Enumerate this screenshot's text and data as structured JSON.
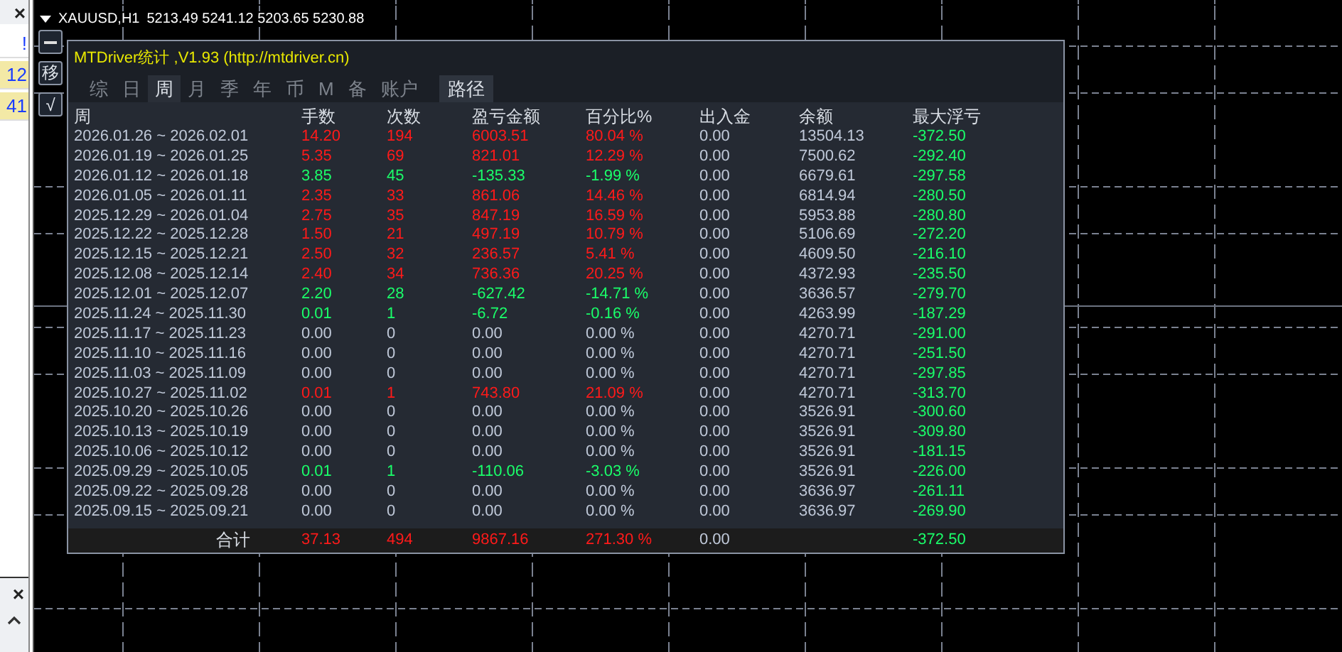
{
  "left_panel": {
    "close_top": "×",
    "cells": [
      {
        "text": "!",
        "highlighted": false
      },
      {
        "text": "12",
        "highlighted": true
      },
      {
        "text": "41",
        "highlighted": true
      }
    ],
    "close_bottom": "×"
  },
  "chart": {
    "symbol": "XAUUSD,H1",
    "prices": "5213.49 5241.12 5203.65 5230.88"
  },
  "side_buttons": [
    "移",
    "√"
  ],
  "panel": {
    "title": "MTDriver统计 ,V1.93 (http://mtdriver.cn)",
    "tabs": [
      {
        "label": "综",
        "selected": false
      },
      {
        "label": "日",
        "selected": false
      },
      {
        "label": "周",
        "selected": true
      },
      {
        "label": "月",
        "selected": false
      },
      {
        "label": "季",
        "selected": false
      },
      {
        "label": "年",
        "selected": false
      },
      {
        "label": "币",
        "selected": false
      },
      {
        "label": "M",
        "selected": false
      },
      {
        "label": "备",
        "selected": false
      },
      {
        "label": "账户",
        "selected": false
      }
    ],
    "path_button": "路径",
    "table": {
      "columns": [
        "周",
        "手数",
        "次数",
        "盈亏金额",
        "百分比%",
        "出入金",
        "余额",
        "最大浮亏"
      ],
      "rows": [
        {
          "cells": [
            "2026.01.26 ~ 2026.02.01",
            "14.20",
            "194",
            "6003.51",
            "80.04 %",
            "0.00",
            "13504.13",
            "-372.50"
          ],
          "kind": "profit"
        },
        {
          "cells": [
            "2026.01.19 ~ 2026.01.25",
            "5.35",
            "69",
            "821.01",
            "12.29 %",
            "0.00",
            "7500.62",
            "-292.40"
          ],
          "kind": "profit"
        },
        {
          "cells": [
            "2026.01.12 ~ 2026.01.18",
            "3.85",
            "45",
            "-135.33",
            "-1.99 %",
            "0.00",
            "6679.61",
            "-297.58"
          ],
          "kind": "loss"
        },
        {
          "cells": [
            "2026.01.05 ~ 2026.01.11",
            "2.35",
            "33",
            "861.06",
            "14.46 %",
            "0.00",
            "6814.94",
            "-280.50"
          ],
          "kind": "profit"
        },
        {
          "cells": [
            "2025.12.29 ~ 2026.01.04",
            "2.75",
            "35",
            "847.19",
            "16.59 %",
            "0.00",
            "5953.88",
            "-280.80"
          ],
          "kind": "profit"
        },
        {
          "cells": [
            "2025.12.22 ~ 2025.12.28",
            "1.50",
            "21",
            "497.19",
            "10.79 %",
            "0.00",
            "5106.69",
            "-272.20"
          ],
          "kind": "profit"
        },
        {
          "cells": [
            "2025.12.15 ~ 2025.12.21",
            "2.50",
            "32",
            "236.57",
            "5.41 %",
            "0.00",
            "4609.50",
            "-216.10"
          ],
          "kind": "profit"
        },
        {
          "cells": [
            "2025.12.08 ~ 2025.12.14",
            "2.40",
            "34",
            "736.36",
            "20.25 %",
            "0.00",
            "4372.93",
            "-235.50"
          ],
          "kind": "profit"
        },
        {
          "cells": [
            "2025.12.01 ~ 2025.12.07",
            "2.20",
            "28",
            "-627.42",
            "-14.71 %",
            "0.00",
            "3636.57",
            "-279.70"
          ],
          "kind": "loss"
        },
        {
          "cells": [
            "2025.11.24 ~ 2025.11.30",
            "0.01",
            "1",
            "-6.72",
            "-0.16 %",
            "0.00",
            "4263.99",
            "-187.29"
          ],
          "kind": "loss"
        },
        {
          "cells": [
            "2025.11.17 ~ 2025.11.23",
            "0.00",
            "0",
            "0.00",
            "0.00 %",
            "0.00",
            "4270.71",
            "-291.00"
          ],
          "kind": "flat"
        },
        {
          "cells": [
            "2025.11.10 ~ 2025.11.16",
            "0.00",
            "0",
            "0.00",
            "0.00 %",
            "0.00",
            "4270.71",
            "-251.50"
          ],
          "kind": "flat"
        },
        {
          "cells": [
            "2025.11.03 ~ 2025.11.09",
            "0.00",
            "0",
            "0.00",
            "0.00 %",
            "0.00",
            "4270.71",
            "-297.85"
          ],
          "kind": "flat"
        },
        {
          "cells": [
            "2025.10.27 ~ 2025.11.02",
            "0.01",
            "1",
            "743.80",
            "21.09 %",
            "0.00",
            "4270.71",
            "-313.70"
          ],
          "kind": "profit"
        },
        {
          "cells": [
            "2025.10.20 ~ 2025.10.26",
            "0.00",
            "0",
            "0.00",
            "0.00 %",
            "0.00",
            "3526.91",
            "-300.60"
          ],
          "kind": "flat"
        },
        {
          "cells": [
            "2025.10.13 ~ 2025.10.19",
            "0.00",
            "0",
            "0.00",
            "0.00 %",
            "0.00",
            "3526.91",
            "-309.80"
          ],
          "kind": "flat"
        },
        {
          "cells": [
            "2025.10.06 ~ 2025.10.12",
            "0.00",
            "0",
            "0.00",
            "0.00 %",
            "0.00",
            "3526.91",
            "-181.15"
          ],
          "kind": "flat"
        },
        {
          "cells": [
            "2025.09.29 ~ 2025.10.05",
            "0.01",
            "1",
            "-110.06",
            "-3.03 %",
            "0.00",
            "3526.91",
            "-226.00"
          ],
          "kind": "loss"
        },
        {
          "cells": [
            "2025.09.22 ~ 2025.09.28",
            "0.00",
            "0",
            "0.00",
            "0.00 %",
            "0.00",
            "3636.97",
            "-261.11"
          ],
          "kind": "flat"
        },
        {
          "cells": [
            "2025.09.15 ~ 2025.09.21",
            "0.00",
            "0",
            "0.00",
            "0.00 %",
            "0.00",
            "3636.97",
            "-269.90"
          ],
          "kind": "flat"
        }
      ],
      "total": {
        "label": "合计",
        "lots": "37.13",
        "trades": "494",
        "profit": "9867.16",
        "percent": "271.30 %",
        "deposit": "0.00",
        "max_drawdown": "-372.50",
        "kind": "profit"
      }
    }
  }
}
